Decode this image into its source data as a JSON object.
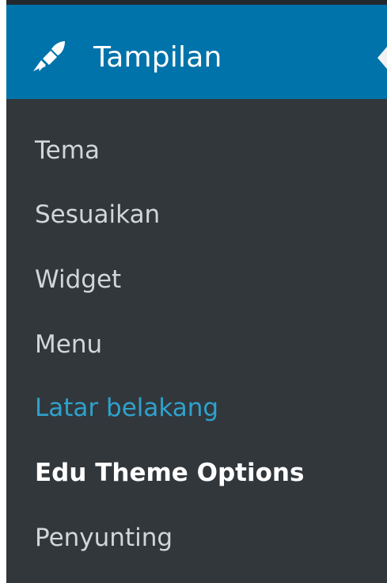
{
  "header": {
    "title": "Tampilan",
    "icon": "paintbrush-icon",
    "collapse_icon": "collapse-arrow-icon",
    "accent_color": "#0073aa"
  },
  "submenu": {
    "items": [
      {
        "label": "Tema"
      },
      {
        "label": "Sesuaikan"
      },
      {
        "label": "Widget"
      },
      {
        "label": "Menu"
      },
      {
        "label": "Latar belakang",
        "state": "hover",
        "color": "#2ea2cc"
      },
      {
        "label": "Edu Theme Options",
        "state": "current"
      },
      {
        "label": "Penyunting"
      }
    ]
  }
}
